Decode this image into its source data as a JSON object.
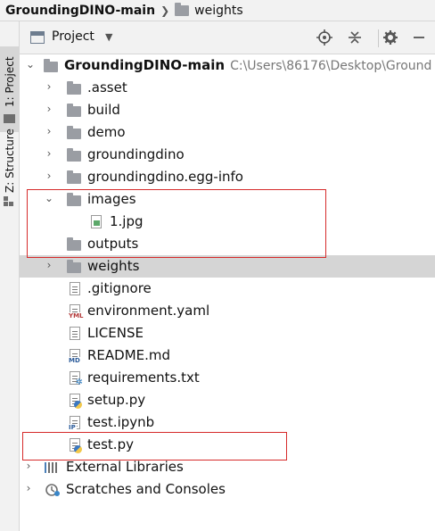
{
  "breadcrumb": {
    "root": "GroundingDINO-main",
    "child": "weights"
  },
  "tool_window": {
    "strip_project_label": "1: Project",
    "strip_structure_label": "Z: Structure",
    "title": "Project"
  },
  "tree": {
    "root": {
      "name": "GroundingDINO-main",
      "path": "C:\\Users\\86176\\Desktop\\Ground"
    },
    "items": [
      {
        "name": ".asset"
      },
      {
        "name": "build"
      },
      {
        "name": "demo"
      },
      {
        "name": "groundingdino"
      },
      {
        "name": "groundingdino.egg-info"
      },
      {
        "name": "images"
      },
      {
        "name": "1.jpg"
      },
      {
        "name": "outputs"
      },
      {
        "name": "weights"
      },
      {
        "name": ".gitignore"
      },
      {
        "name": "environment.yaml",
        "badge": "YML"
      },
      {
        "name": "LICENSE"
      },
      {
        "name": "README.md",
        "badge": "MD"
      },
      {
        "name": "requirements.txt"
      },
      {
        "name": "setup.py"
      },
      {
        "name": "test.ipynb",
        "badge": "IP"
      },
      {
        "name": "test.py"
      }
    ],
    "external_libraries": "External Libraries",
    "scratches": "Scratches and Consoles"
  },
  "colors": {
    "selection": "#d5d5d5",
    "highlight_box": "#d62b2b",
    "folder": "#9a9da3"
  }
}
